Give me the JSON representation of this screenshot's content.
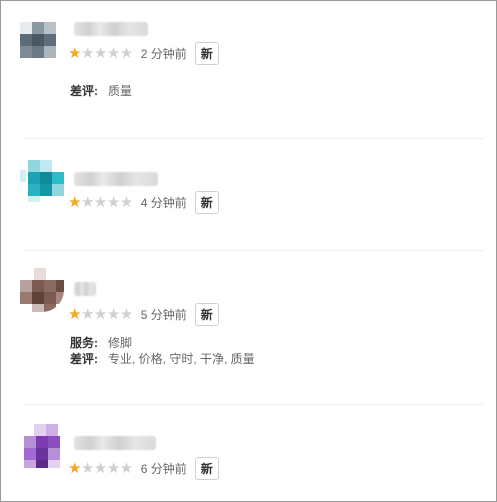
{
  "reviews": [
    {
      "avatar_colors": [
        "#5b6b77",
        "#7c8a94",
        "#4a5863"
      ],
      "rating": 1,
      "stars": {
        "filled": "★",
        "empty": "★★★★"
      },
      "time": "2 分钟前",
      "badge": "新",
      "details": [
        {
          "label": "差评:",
          "value": "质量"
        }
      ]
    },
    {
      "avatar_colors": [
        "#1aa3b3",
        "#2bbcc9",
        "#0f8a99"
      ],
      "rating": 1,
      "stars": {
        "filled": "★",
        "empty": "★★★★"
      },
      "time": "4 分钟前",
      "badge": "新",
      "details": []
    },
    {
      "avatar_colors": [
        "#7b5a52",
        "#9a7a70",
        "#5e423a"
      ],
      "rating": 1,
      "stars": {
        "filled": "★",
        "empty": "★★★★"
      },
      "time": "5 分钟前",
      "badge": "新",
      "details": [
        {
          "label": "服务:",
          "value": "修脚"
        },
        {
          "label": "差评:",
          "value": "专业, 价格, 守时, 干净, 质量"
        }
      ]
    },
    {
      "avatar_colors": [
        "#7d3db0",
        "#a06bd0",
        "#5c2a88"
      ],
      "rating": 1,
      "stars": {
        "filled": "★",
        "empty": "★★★★"
      },
      "time": "6 分钟前",
      "badge": "新",
      "details": []
    }
  ]
}
